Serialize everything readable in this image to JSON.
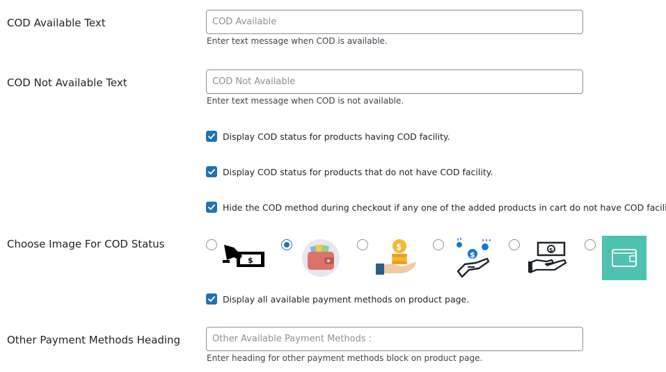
{
  "cod_available": {
    "label": "COD Available Text",
    "placeholder": "COD Available",
    "value": "",
    "description": "Enter text message when COD is available."
  },
  "cod_not_available": {
    "label": "COD Not Available Text",
    "placeholder": "COD Not Available",
    "value": "",
    "description": "Enter text message when COD is not available."
  },
  "checkboxes": [
    {
      "label": "Display COD status for products having COD facility.",
      "checked": true
    },
    {
      "label": "Display COD status for products that do not have COD facility.",
      "checked": true
    },
    {
      "label": "Hide the COD method during checkout if any one of the added products in cart do not have COD facility.",
      "checked": true
    }
  ],
  "image_choice": {
    "label": "Choose Image For COD Status",
    "options": [
      {
        "icon": "cash-hand-black-icon",
        "selected": false
      },
      {
        "icon": "wallet-icon",
        "selected": true
      },
      {
        "icon": "coins-hand-icon",
        "selected": false
      },
      {
        "icon": "dollar-hand-icon",
        "selected": false
      },
      {
        "icon": "banknote-hand-icon",
        "selected": false
      },
      {
        "icon": "wallet-teal-icon",
        "selected": false
      }
    ]
  },
  "display_methods": {
    "label": "Display all available payment methods on product page.",
    "checked": true
  },
  "other_methods": {
    "label": "Other Payment Methods Heading",
    "placeholder": "Other Available Payment Methods :",
    "value": "",
    "description": "Enter heading for other payment methods block on product page."
  },
  "colors": {
    "accent": "#2271b1",
    "teal": "#4fc1b1",
    "gold": "#f5b82e"
  }
}
